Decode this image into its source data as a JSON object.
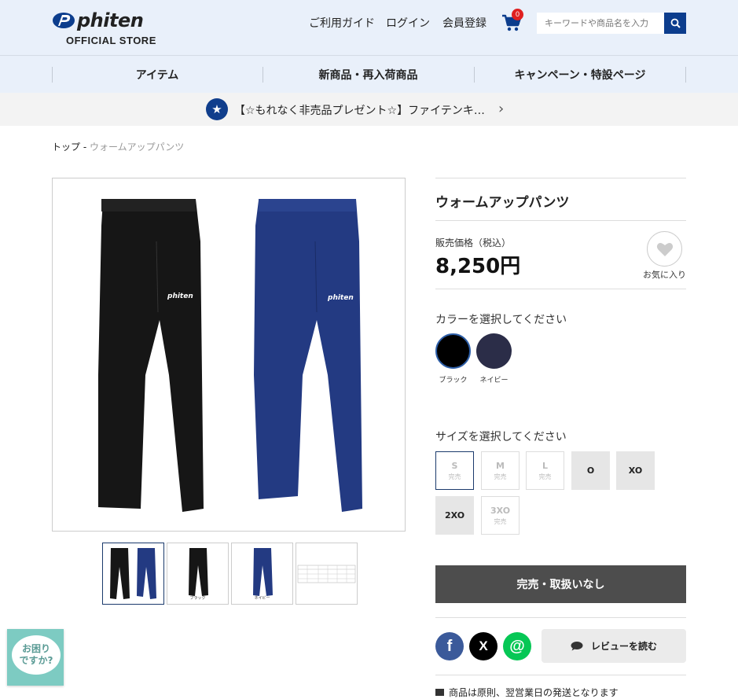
{
  "header": {
    "logo_text": "phiten",
    "logo_sub": "OFFICIAL STORE",
    "nav": [
      "ご利用ガイド",
      "ログイン",
      "会員登録"
    ],
    "cart_count": "0",
    "search_placeholder": "キーワードや商品名を入力",
    "icons": {
      "cart": "cart-icon",
      "search": "search-icon"
    }
  },
  "categories": [
    "アイテム",
    "新商品・再入荷商品",
    "キャンペーン・特設ページ"
  ],
  "promo": {
    "text": "【☆もれなく非売品プレゼント☆】ファイテンキ…",
    "icon": "star-icon"
  },
  "breadcrumb": {
    "top": "トップ",
    "sep": " - ",
    "current": "ウォームアップパンツ"
  },
  "gallery": {
    "thumbnails": [
      {
        "label": ""
      },
      {
        "label": "ブラック"
      },
      {
        "label": "ネイビー"
      },
      {
        "label": ""
      }
    ]
  },
  "product": {
    "title": "ウォームアップパンツ",
    "price_label": "販売価格（税込）",
    "price": "8,250円",
    "favorite_label": "お気に入り",
    "color_heading": "カラーを選択してください",
    "colors": [
      {
        "name": "ブラック",
        "hex": "#000000"
      },
      {
        "name": "ネイビー",
        "hex": "#2b2d48"
      }
    ],
    "size_heading": "サイズを選択してください",
    "sizes": [
      {
        "code": "S",
        "status": "完売"
      },
      {
        "code": "M",
        "status": "完売"
      },
      {
        "code": "L",
        "status": "完売"
      },
      {
        "code": "O",
        "status": ""
      },
      {
        "code": "XO",
        "status": ""
      },
      {
        "code": "2XO",
        "status": ""
      },
      {
        "code": "3XO",
        "status": "完売"
      }
    ],
    "soldout_button": "完売・取扱いなし",
    "review_button": "レビューを読む",
    "shipping_note": "商品は原則、翌営業日の発送となります"
  },
  "social": {
    "facebook": "f",
    "x": "X",
    "line": "@"
  },
  "help": {
    "text": "お困り\nですか?"
  },
  "colors": {
    "brand_navy": "#0c3d8d",
    "header_bg": "#e9f0fa",
    "soldout_bg": "#4d4d4d",
    "help_bg": "#7dcbc2"
  }
}
